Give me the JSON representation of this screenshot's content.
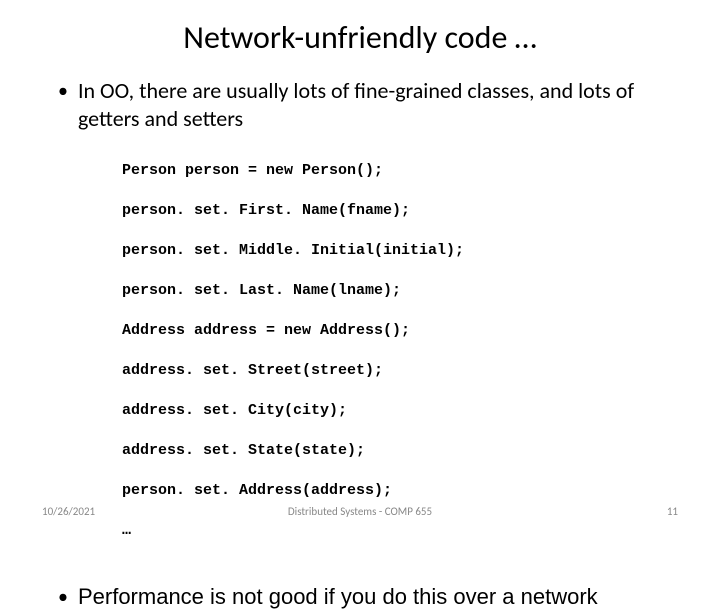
{
  "title": "Network-unfriendly code …",
  "bullets": {
    "first": "In OO, there are usually lots of fine-grained classes, and lots of getters and setters",
    "second": "Performance is not good if you do this over a network"
  },
  "code": {
    "line1": "Person person = new Person();",
    "line2": "person. set. First. Name(fname);",
    "line3": "person. set. Middle. Initial(initial);",
    "line4": "person. set. Last. Name(lname);",
    "line5": "Address address = new Address();",
    "line6": "address. set. Street(street);",
    "line7": "address. set. City(city);",
    "line8": "address. set. State(state);",
    "line9": "person. set. Address(address);",
    "line10": "…"
  },
  "footer": {
    "date": "10/26/2021",
    "course": "Distributed Systems - COMP 655",
    "page": "11"
  }
}
